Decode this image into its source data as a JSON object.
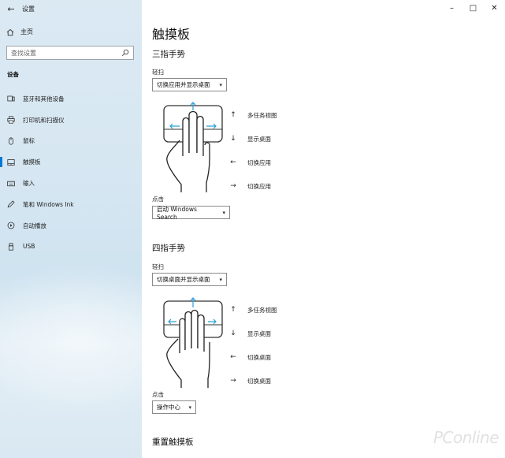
{
  "window": {
    "title": "设置",
    "back_glyph": "←",
    "controls": {
      "minimize": "–",
      "maximize": "□",
      "close": "✕"
    }
  },
  "sidebar": {
    "home_label": "主页",
    "search_placeholder": "查找设置",
    "section_label": "设备",
    "items": [
      {
        "label": "蓝牙和其他设备",
        "icon": "bluetooth-devices-icon"
      },
      {
        "label": "打印机和扫描仪",
        "icon": "printer-icon"
      },
      {
        "label": "鼠标",
        "icon": "mouse-icon"
      },
      {
        "label": "触摸板",
        "icon": "touchpad-icon",
        "active": true
      },
      {
        "label": "输入",
        "icon": "keyboard-icon"
      },
      {
        "label": "笔和 Windows Ink",
        "icon": "pen-icon"
      },
      {
        "label": "自动播放",
        "icon": "autoplay-icon"
      },
      {
        "label": "USB",
        "icon": "usb-icon"
      }
    ]
  },
  "main": {
    "page_title": "触摸板",
    "three_finger": {
      "heading": "三指手势",
      "swipe_label": "轻扫",
      "swipe_value": "切换应用并显示桌面",
      "gestures": [
        {
          "arrow": "↑",
          "label": "多任务视图"
        },
        {
          "arrow": "↓",
          "label": "显示桌面"
        },
        {
          "arrow": "←",
          "label": "切换应用"
        },
        {
          "arrow": "→",
          "label": "切换应用"
        }
      ],
      "tap_label": "点击",
      "tap_value": "启动 Windows Search"
    },
    "four_finger": {
      "heading": "四指手势",
      "swipe_label": "轻扫",
      "swipe_value": "切换桌面并显示桌面",
      "gestures": [
        {
          "arrow": "↑",
          "label": "多任务视图"
        },
        {
          "arrow": "↓",
          "label": "显示桌面"
        },
        {
          "arrow": "←",
          "label": "切换桌面"
        },
        {
          "arrow": "→",
          "label": "切换桌面"
        }
      ],
      "tap_label": "点击",
      "tap_value": "操作中心"
    },
    "reset_heading": "重置触摸板"
  },
  "watermark": "PConline",
  "colors": {
    "accent": "#0078d7",
    "gesture_arrow": "#2a9fd6"
  }
}
